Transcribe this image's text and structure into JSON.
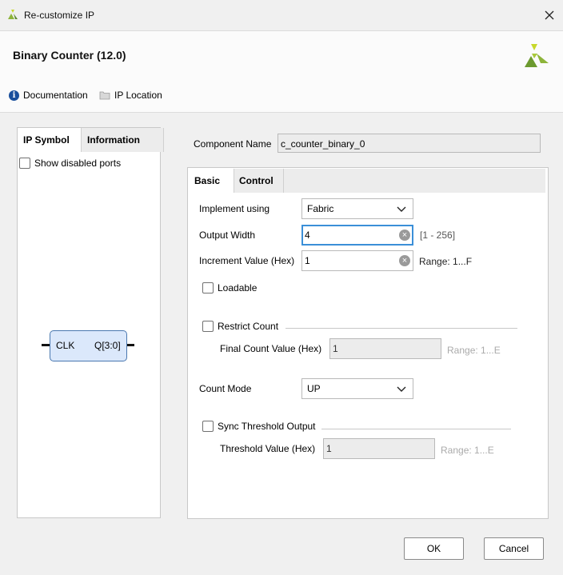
{
  "window": {
    "title": "Re-customize IP",
    "close_icon": "close-icon"
  },
  "header": {
    "ip_title": "Binary Counter (12.0)",
    "documentation_label": "Documentation",
    "ip_location_label": "IP Location"
  },
  "left_panel": {
    "tabs": [
      {
        "label": "IP Symbol",
        "active": true
      },
      {
        "label": "Information",
        "active": false
      }
    ],
    "show_disabled_ports": {
      "label": "Show disabled ports",
      "checked": false
    },
    "symbol": {
      "input_port": "CLK",
      "output_port": "Q[3:0]"
    }
  },
  "component": {
    "label": "Component Name",
    "value": "c_counter_binary_0"
  },
  "config_tabs": [
    {
      "label": "Basic",
      "active": true
    },
    {
      "label": "Control",
      "active": false
    }
  ],
  "basic": {
    "implement_using": {
      "label": "Implement using",
      "value": "Fabric"
    },
    "output_width": {
      "label": "Output Width",
      "value": "4",
      "range": "[1 - 256]"
    },
    "increment_value": {
      "label": "Increment Value (Hex)",
      "value": "1",
      "range": "Range: 1...F"
    },
    "loadable": {
      "label": "Loadable",
      "checked": false
    },
    "restrict_count": {
      "label": "Restrict Count",
      "checked": false
    },
    "final_count_value": {
      "label": "Final Count Value (Hex)",
      "value": "1",
      "range": "Range: 1...E"
    },
    "count_mode": {
      "label": "Count Mode",
      "value": "UP"
    },
    "sync_threshold_output": {
      "label": "Sync Threshold Output",
      "checked": false
    },
    "threshold_value": {
      "label": "Threshold Value (Hex)",
      "value": "1",
      "range": "Range: 1...E"
    }
  },
  "buttons": {
    "ok": "OK",
    "cancel": "Cancel"
  },
  "colors": {
    "accent_focus": "#3b8fd8",
    "logo_green": "#8db43a",
    "symbol_fill": "#dbe8fb",
    "symbol_border": "#4a78b0"
  }
}
